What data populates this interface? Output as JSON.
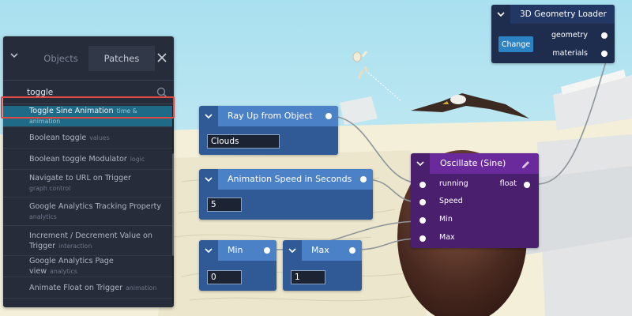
{
  "panel": {
    "tabs": [
      "Objects",
      "Patches"
    ],
    "active_tab": "Patches",
    "search": {
      "value": "toggle",
      "placeholder": ""
    },
    "results": [
      {
        "label": "Toggle Sine Animation",
        "category": "time & animation",
        "selected": true
      },
      {
        "label": "Boolean toggle",
        "category": "values"
      },
      {
        "label": "Boolean toggle Modulator",
        "category": "logic"
      },
      {
        "label": "Navigate to URL on Trigger",
        "category": "graph control"
      },
      {
        "label": "Google Analytics Tracking Property",
        "category": "analytics"
      },
      {
        "label": "Increment / Decrement Value on Trigger",
        "category": "interaction"
      },
      {
        "label": "Google Analytics Page view",
        "category": "analytics"
      },
      {
        "label": "Animate Float on Trigger",
        "category": "animation"
      }
    ]
  },
  "nodes": {
    "ray": {
      "title": "Ray Up from Object",
      "value": "Clouds"
    },
    "speed": {
      "title": "Animation Speed in Seconds",
      "value": "5"
    },
    "min": {
      "title": "Min",
      "value": "0"
    },
    "max": {
      "title": "Max",
      "value": "1"
    },
    "oscillate": {
      "title": "Oscillate (Sine)",
      "inputs": [
        "running",
        "Speed",
        "Min",
        "Max"
      ],
      "output": "float"
    },
    "geometry_loader": {
      "title": "3D Geometry Loader",
      "button": "Change",
      "outputs": [
        "geometry",
        "materials"
      ]
    }
  },
  "colors": {
    "panel_bg": "#262c3a",
    "selected_row": "#1f6b87",
    "selection_outline": "#e04a40",
    "node_blue": "#2f5a96",
    "node_blue_header": "#4b82c7",
    "node_purple": "#4a1f6e",
    "node_purple_header": "#6b2a9c",
    "node_navy": "#1e2c4d",
    "sky": "#b8e6f2"
  }
}
